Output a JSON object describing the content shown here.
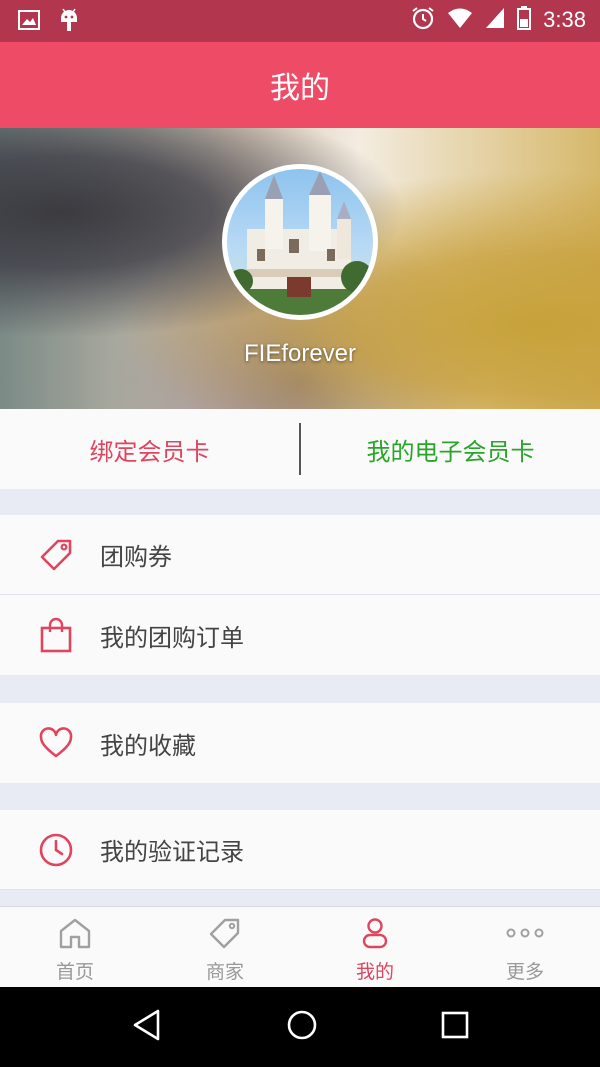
{
  "status_bar": {
    "time": "3:38",
    "icons": [
      "image-icon",
      "android-icon",
      "alarm-icon",
      "wifi-icon",
      "signal-icon",
      "battery-icon"
    ]
  },
  "app_bar": {
    "title": "我的"
  },
  "profile": {
    "username": "FIEforever",
    "avatar": "castle-avatar"
  },
  "membership": {
    "bind_card": "绑定会员卡",
    "e_card": "我的电子会员卡",
    "colors": {
      "bind": "#e0455f",
      "ecard": "#2aa52a"
    }
  },
  "menu": {
    "group1": [
      {
        "label": "团购券",
        "icon": "tag-icon"
      },
      {
        "label": "我的团购订单",
        "icon": "shopping-bag-icon"
      }
    ],
    "group2": [
      {
        "label": "我的收藏",
        "icon": "heart-icon"
      }
    ],
    "group3": [
      {
        "label": "我的验证记录",
        "icon": "clock-icon"
      }
    ]
  },
  "tabs": [
    {
      "label": "首页",
      "icon": "home-icon"
    },
    {
      "label": "商家",
      "icon": "tag-icon"
    },
    {
      "label": "我的",
      "icon": "person-icon",
      "active": true
    },
    {
      "label": "更多",
      "icon": "more-icon"
    }
  ],
  "theme": {
    "accent": "#ee4b66",
    "status": "#b2364e"
  }
}
